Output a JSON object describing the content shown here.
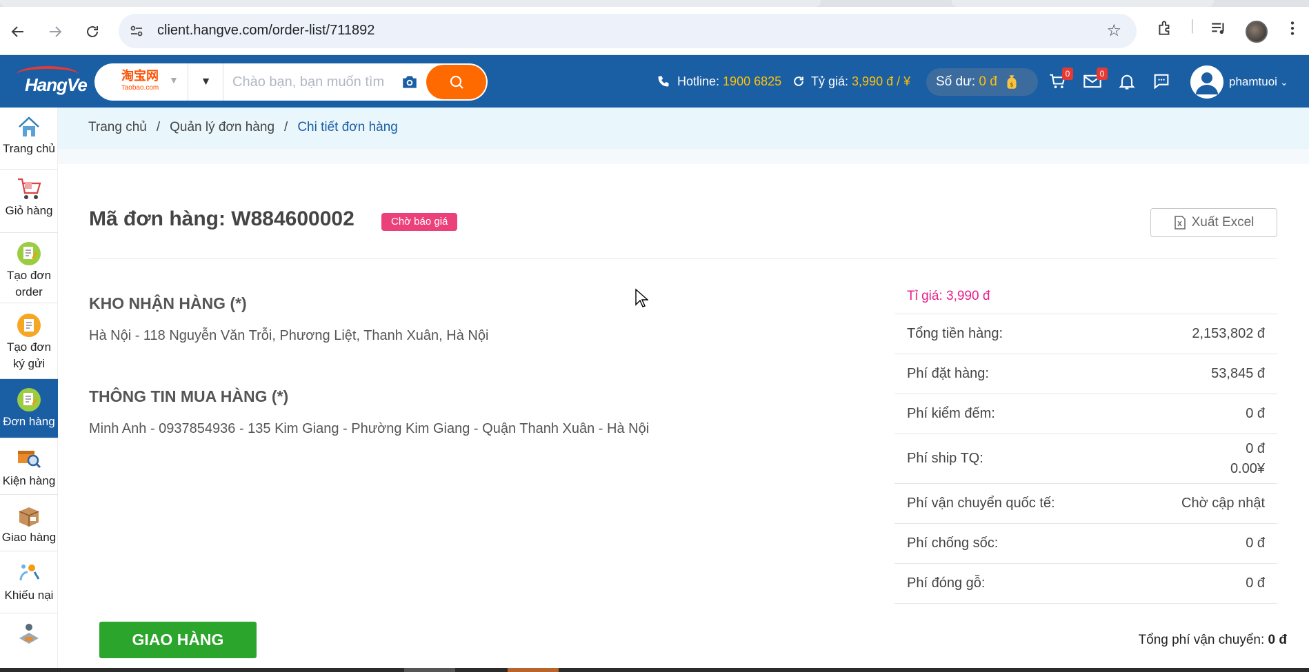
{
  "browser": {
    "url": "client.hangve.com/order-list/711892"
  },
  "header": {
    "site_cn": "淘宝网",
    "site_en": "Taobao.com",
    "search_placeholder": "Chào bạn, bạn muốn tìm",
    "hotline_label": "Hotline:",
    "hotline_value": "1900 6825",
    "rate_label": "Tỷ giá:",
    "rate_value": "3,990 đ / ¥",
    "balance_label": "Số dư:",
    "balance_value": "0 đ",
    "cart_count": "0",
    "mail_count": "0",
    "username": "phamtuoi"
  },
  "sidebar": {
    "items": [
      {
        "label": "Trang chủ",
        "icon": "home-icon"
      },
      {
        "label": "Giỏ hàng",
        "icon": "cart-icon"
      },
      {
        "label": "Tạo đơn order",
        "icon": "create-order-icon"
      },
      {
        "label": "Tạo đơn ký gửi",
        "icon": "consign-icon"
      },
      {
        "label": "Đơn hàng",
        "icon": "orders-icon"
      },
      {
        "label": "Kiện hàng",
        "icon": "package-icon"
      },
      {
        "label": "Giao hàng",
        "icon": "delivery-icon"
      },
      {
        "label": "Khiếu nại",
        "icon": "complaint-icon"
      }
    ],
    "item_labels": {
      "home": "Trang chủ",
      "cart": "Giỏ hàng",
      "create_order_1": "Tạo đơn",
      "create_order_2": "order",
      "consign_1": "Tạo đơn",
      "consign_2": "ký gửi",
      "orders": "Đơn hàng",
      "packages": "Kiện hàng",
      "delivery": "Giao hàng",
      "complaints": "Khiếu nại"
    }
  },
  "breadcrumb": {
    "home": "Trang chủ",
    "orders": "Quản lý đơn hàng",
    "current": "Chi tiết đơn hàng",
    "sep": "/"
  },
  "order": {
    "title": "Mã đơn hàng: W884600002",
    "status": "Chờ báo giá",
    "export_label": "Xuất Excel",
    "warehouse_heading": "KHO NHẬN HÀNG (*)",
    "warehouse_address": "Hà Nội - 118 Nguyễn Văn Trỗi, Phương Liệt, Thanh Xuân, Hà Nội",
    "buyer_heading": "THÔNG TIN MUA HÀNG (*)",
    "buyer_info": "Minh Anh - 0937854936 - 135 Kim Giang - Phường Kim Giang - Quận Thanh Xuân - Hà Nội"
  },
  "costs": {
    "rate": "Tỉ giá: 3,990 đ",
    "rows": [
      {
        "label": "Tổng tiền hàng:",
        "value": "2,153,802 đ"
      },
      {
        "label": "Phí đặt hàng:",
        "value": "53,845 đ"
      },
      {
        "label": "Phí kiểm đếm:",
        "value": "0 đ"
      },
      {
        "label": "Phí ship TQ:",
        "value": "0 đ",
        "value2": "0.00¥"
      },
      {
        "label": "Phí vận chuyển quốc tế:",
        "value": "Chờ cập nhật"
      },
      {
        "label": "Phí chống sốc:",
        "value": "0 đ"
      },
      {
        "label": "Phí đóng gỗ:",
        "value": "0 đ"
      }
    ]
  },
  "footer": {
    "deliver_button": "GIAO HÀNG",
    "total_ship_label": "Tổng phí vận chuyển:",
    "total_ship_value": "0 đ"
  },
  "colors": {
    "header_bg": "#1a5ea4",
    "accent_orange": "#ff6a00",
    "status_pink": "#ec407a",
    "rate_pink": "#e91e8c",
    "deliver_green": "#2ba52b",
    "highlight_yellow": "#ffc107"
  }
}
